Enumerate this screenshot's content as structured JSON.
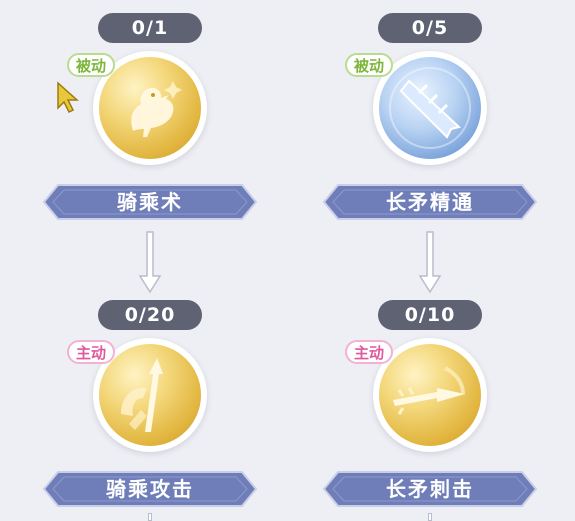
{
  "skills": {
    "riding": {
      "count": "0/1",
      "tag": "被动",
      "name": "骑乘术"
    },
    "spear_mastery": {
      "count": "0/5",
      "tag": "被动",
      "name": "长矛精通"
    },
    "riding_attack": {
      "count": "0/20",
      "tag": "主动",
      "name": "骑乘攻击"
    },
    "spear_thrust": {
      "count": "0/10",
      "tag": "主动",
      "name": "长矛刺击"
    }
  },
  "icons": {
    "riding": "chocobo-mount-icon",
    "spear_mastery": "spear-head-icon",
    "riding_attack": "mounted-spear-icon",
    "spear_thrust": "spear-thrust-icon"
  },
  "colors": {
    "background": "#eeeff4",
    "counter": "#5e6273",
    "passive": "#7cb63b",
    "active": "#e0579e",
    "banner": "#6f7eb8",
    "gold": "#e2b640",
    "blue": "#7ea6dc"
  }
}
